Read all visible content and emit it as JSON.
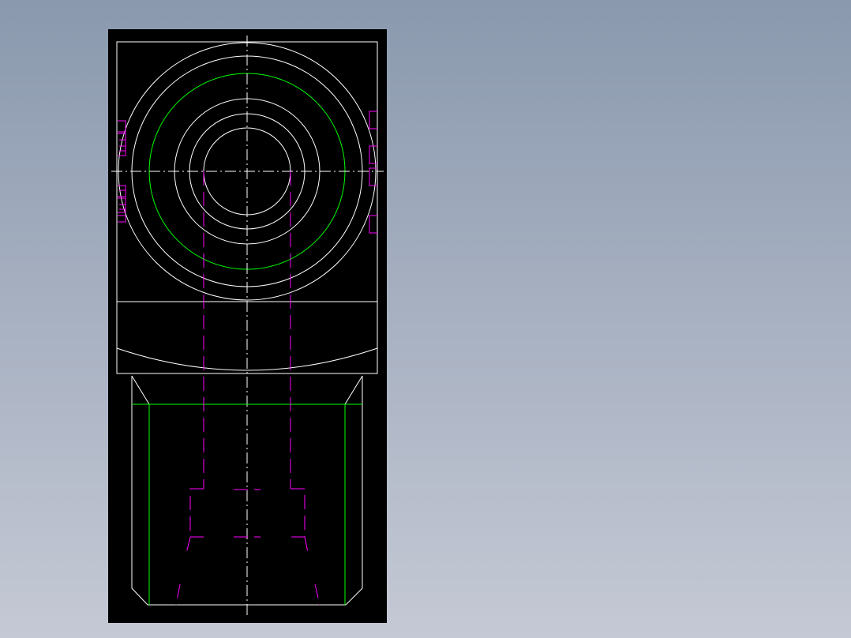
{
  "viewer": {
    "background_gradient_top": "#8a99ae",
    "background_gradient_bottom": "#c5c9d5",
    "viewport_background": "#000000"
  },
  "drawing": {
    "layers": [
      {
        "name": "outline",
        "color": "#ffffff"
      },
      {
        "name": "centerline",
        "color": "#ffffff"
      },
      {
        "name": "hidden",
        "color": "#ff00ff"
      },
      {
        "name": "thread",
        "color": "#00ff00"
      },
      {
        "name": "dimension-ticks",
        "color": "#ff00ff"
      }
    ],
    "views": [
      {
        "name": "top-view",
        "shape": "square block with concentric bores"
      },
      {
        "name": "front-view",
        "shape": "tapered body with stepped hidden bore"
      }
    ]
  }
}
